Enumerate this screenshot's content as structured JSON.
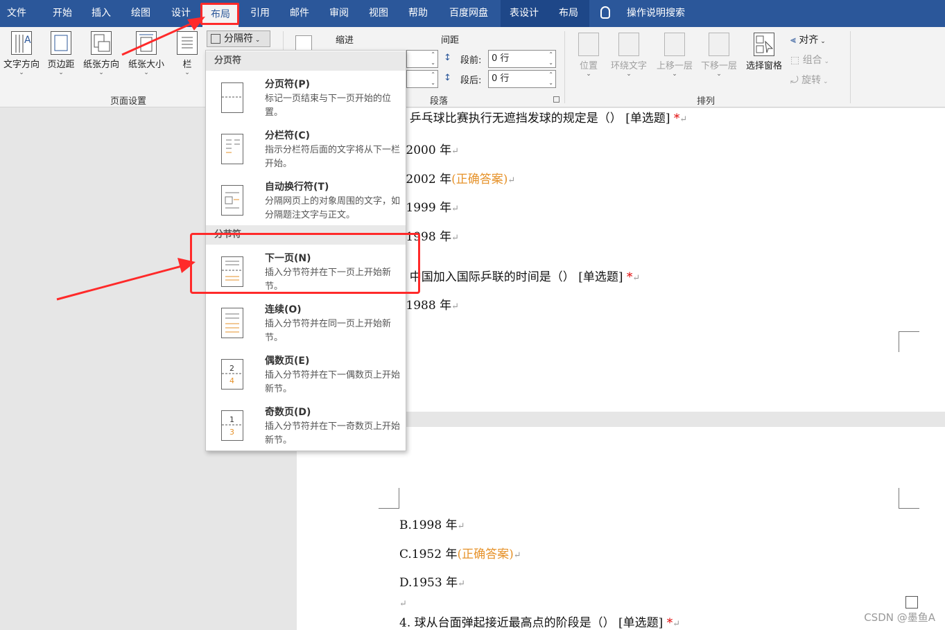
{
  "tabs": [
    "文件",
    "开始",
    "插入",
    "绘图",
    "设计",
    "布局",
    "引用",
    "邮件",
    "审阅",
    "视图",
    "帮助",
    "百度网盘",
    "表设计",
    "布局"
  ],
  "search_label": "操作说明搜索",
  "ribbon": {
    "page_setup": {
      "buttons": [
        "文字方向",
        "页边距",
        "纸张方向",
        "纸张大小",
        "栏"
      ],
      "group_label": "页面设置"
    },
    "breaks_button": "分隔符",
    "paragraph": {
      "indent_label": "缩进",
      "spacing_label": "间距",
      "before_label": "段前:",
      "before_value": "0 行",
      "after_label": "段后:",
      "after_value": "0 行",
      "group_label": "段落"
    },
    "arrange": {
      "buttons": [
        "位置",
        "环绕文字",
        "上移一层",
        "下移一层",
        "选择窗格"
      ],
      "small": [
        "对齐",
        "组合",
        "旋转"
      ],
      "group_label": "排列"
    }
  },
  "breaks_menu": {
    "page_header": "分页符",
    "section_header": "分节符",
    "items": [
      {
        "title": "分页符(P)",
        "desc": "标记一页结束与下一页开始的位置。"
      },
      {
        "title": "分栏符(C)",
        "desc": "指示分栏符后面的文字将从下一栏开始。"
      },
      {
        "title": "自动换行符(T)",
        "desc": "分隔网页上的对象周围的文字，如分隔题注文字与正文。"
      },
      {
        "title": "下一页(N)",
        "desc": "插入分节符并在下一页上开始新节。"
      },
      {
        "title": "连续(O)",
        "desc": "插入分节符并在同一页上开始新节。"
      },
      {
        "title": "偶数页(E)",
        "desc": "插入分节符并在下一偶数页上开始新节。"
      },
      {
        "title": "奇数页(D)",
        "desc": "插入分节符并在下一奇数页上开始新节。"
      }
    ]
  },
  "document": {
    "q2": ". 乒乓球比赛执行无遮挡发球的规定是（） [单选题]",
    "q2_a": ".2000 年",
    "q2_b": ".2002 年",
    "q2_c": ".1999 年",
    "q2_d": ".1998 年",
    "q3": ". 中国加入国际乒联的时间是（） [单选题]",
    "q3_a": ".1988 年",
    "q3_b": "B.1998 年",
    "q3_c": "C.1952 年",
    "q3_d": "D.1953 年",
    "q4": "4. 球从台面弹起接近最高点的阶段是（） [单选题]",
    "correct": "(正确答案)",
    "star": "*",
    "ret": "↵"
  },
  "watermark": "CSDN @墨鱼A",
  "colors": {
    "tabbar": "#2b579a",
    "highlight": "#ff2a2a",
    "correct": "#e6922a",
    "star": "#e00000"
  }
}
